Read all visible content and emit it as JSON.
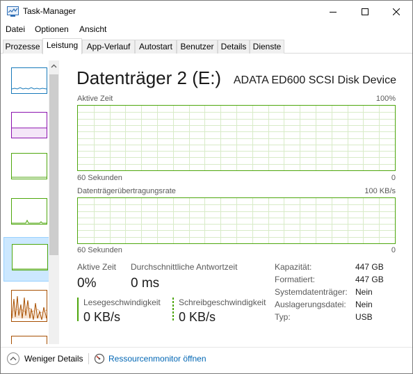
{
  "window": {
    "title": "Task-Manager",
    "minimize_icon": "minimize-icon",
    "maximize_icon": "maximize-icon",
    "close_icon": "close-icon"
  },
  "menu": {
    "items": [
      "Datei",
      "Optionen",
      "Ansicht"
    ]
  },
  "tabs": {
    "items": [
      "Prozesse",
      "Leistung",
      "App-Verlauf",
      "Autostart",
      "Benutzer",
      "Details",
      "Dienste"
    ],
    "active": "Leistung"
  },
  "sidebar": {
    "thumbs": [
      {
        "icon": "cpu-thumbnail",
        "color": "#1779ba"
      },
      {
        "icon": "memory-thumbnail",
        "color": "#8b12ae"
      },
      {
        "icon": "disk-thumbnail",
        "color": "#4da60c"
      },
      {
        "icon": "disk-thumbnail",
        "color": "#4da60c"
      },
      {
        "icon": "disk-thumbnail",
        "color": "#4da60c"
      },
      {
        "icon": "ethernet-thumbnail",
        "color": "#a74f01"
      }
    ],
    "selected_index": 4
  },
  "detail": {
    "title": "Datenträger 2 (E:)",
    "model": "ADATA ED600 SCSI Disk Device",
    "graph1": {
      "label": "Aktive Zeit",
      "max_label": "100%",
      "time_label": "60 Sekunden",
      "min_label": "0"
    },
    "graph2": {
      "label": "Datenträgerübertragungsrate",
      "max_label": "100 KB/s",
      "time_label": "60 Sekunden",
      "min_label": "0"
    },
    "accent_color": "#4da60c",
    "stats": {
      "active_time_label": "Aktive Zeit",
      "active_time_value": "0%",
      "response_label": "Durchschnittliche Antwortzeit",
      "response_value": "0 ms",
      "read_label": "Lesegeschwindigkeit",
      "read_value": "0 KB/s",
      "write_label": "Schreibgeschwindigkeit",
      "write_value": "0 KB/s"
    },
    "properties": [
      {
        "key": "Kapazität:",
        "value": "447 GB"
      },
      {
        "key": "Formatiert:",
        "value": "447 GB"
      },
      {
        "key": "Systemdatenträger:",
        "value": "Nein"
      },
      {
        "key": "Auslagerungsdatei:",
        "value": "Nein"
      },
      {
        "key": "Typ:",
        "value": "USB"
      }
    ]
  },
  "footer": {
    "less_details": "Weniger Details",
    "resource_monitor": "Ressourcenmonitor öffnen"
  }
}
